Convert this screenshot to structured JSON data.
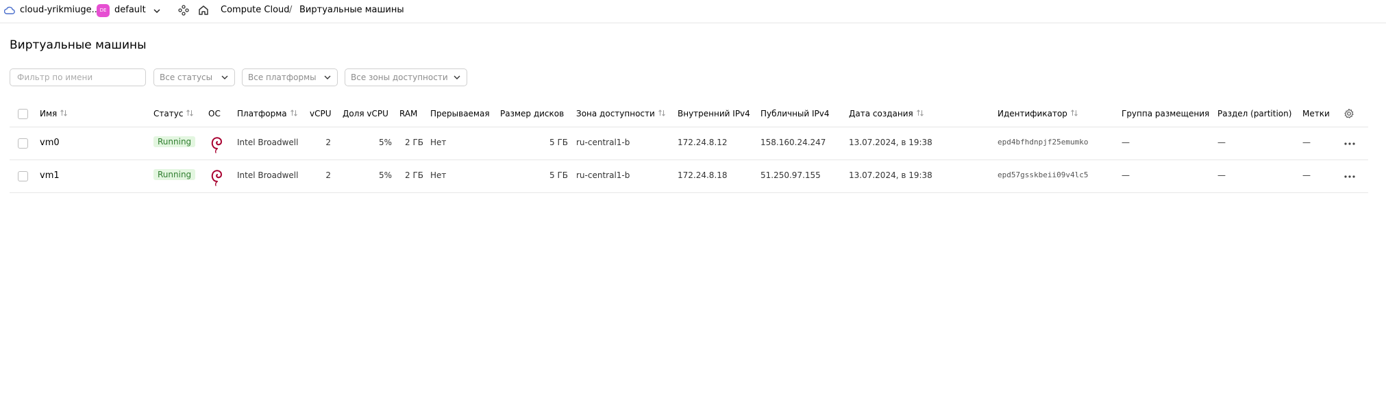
{
  "topbar": {
    "cloud_name": "cloud-yrikmiuge...",
    "folder_badge": "DE",
    "folder_name": "default",
    "breadcrumb": [
      "Compute Cloud",
      "/",
      "Виртуальные машины"
    ],
    "folder_badge_color": "#e64fd2"
  },
  "page": {
    "title": "Виртуальные машины"
  },
  "filters": {
    "name_placeholder": "Фильтр по имени",
    "status": "Все статусы",
    "platform": "Все платформы",
    "zone": "Все зоны доступности"
  },
  "table": {
    "columns": [
      "Имя",
      "Статус",
      "ОС",
      "Платформа",
      "vCPU",
      "Доля vCPU",
      "RAM",
      "Прерываемая",
      "Размер дисков",
      "Зона доступности",
      "Внутренний IPv4",
      "Публичный IPv4",
      "Дата создания",
      "Идентификатор",
      "Группа размещения",
      "Раздел (partition)",
      "Метки"
    ],
    "rows": [
      {
        "name": "vm0",
        "status": "Running",
        "os_icon": "debian-swirl-icon",
        "platform": "Intel Broadwell",
        "vcpu": "2",
        "core_fraction": "5%",
        "ram": "2 ГБ",
        "preemptible": "Нет",
        "disk": "5 ГБ",
        "zone": "ru-central1-b",
        "internal_ip": "172.24.8.12",
        "public_ip": "158.160.24.247",
        "created": "13.07.2024, в 19:38",
        "id": "epd4bfhdnpjf25emumko",
        "placement": "—",
        "partition": "—",
        "labels": "—"
      },
      {
        "name": "vm1",
        "status": "Running",
        "os_icon": "debian-swirl-icon",
        "platform": "Intel Broadwell",
        "vcpu": "2",
        "core_fraction": "5%",
        "ram": "2 ГБ",
        "preemptible": "Нет",
        "disk": "5 ГБ",
        "zone": "ru-central1-b",
        "internal_ip": "172.24.8.18",
        "public_ip": "51.250.97.155",
        "created": "13.07.2024, в 19:38",
        "id": "epd57gsskbeii09v4lc5",
        "placement": "—",
        "partition": "—",
        "labels": "—"
      }
    ]
  },
  "colors": {
    "running_bg": "#e3f6e0",
    "running_text": "#2e7d2e",
    "debian_red": "#a80030"
  }
}
